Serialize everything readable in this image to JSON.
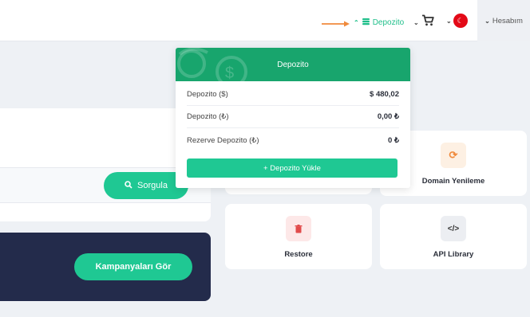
{
  "header": {
    "depozito_label": "Depozito",
    "account_label": "Hesabım"
  },
  "dropdown": {
    "title": "Depozito",
    "rows": [
      {
        "label": "Depozito ($)",
        "value": "$ 480,02"
      },
      {
        "label": "Depozito (₺)",
        "value": "0,00 ₺"
      },
      {
        "label": "Rezerve Depozito (₺)",
        "value": "0 ₺"
      }
    ],
    "load_button": "+ Depozito Yükle"
  },
  "search": {
    "button_label": "Sorgula"
  },
  "campaign": {
    "button_label": "Kampanyaları Gör"
  },
  "tiles": [
    {
      "label": "Domain Yenileme",
      "icon": "refresh-icon"
    },
    {
      "label": "Restore",
      "icon": "trash-icon"
    },
    {
      "label": "API Library",
      "icon": "code-icon"
    }
  ],
  "colors": {
    "accent": "#1fc893",
    "header_green": "#18a56d",
    "dark_card": "#232b4b",
    "annotation_arrow": "#f08a3c"
  }
}
